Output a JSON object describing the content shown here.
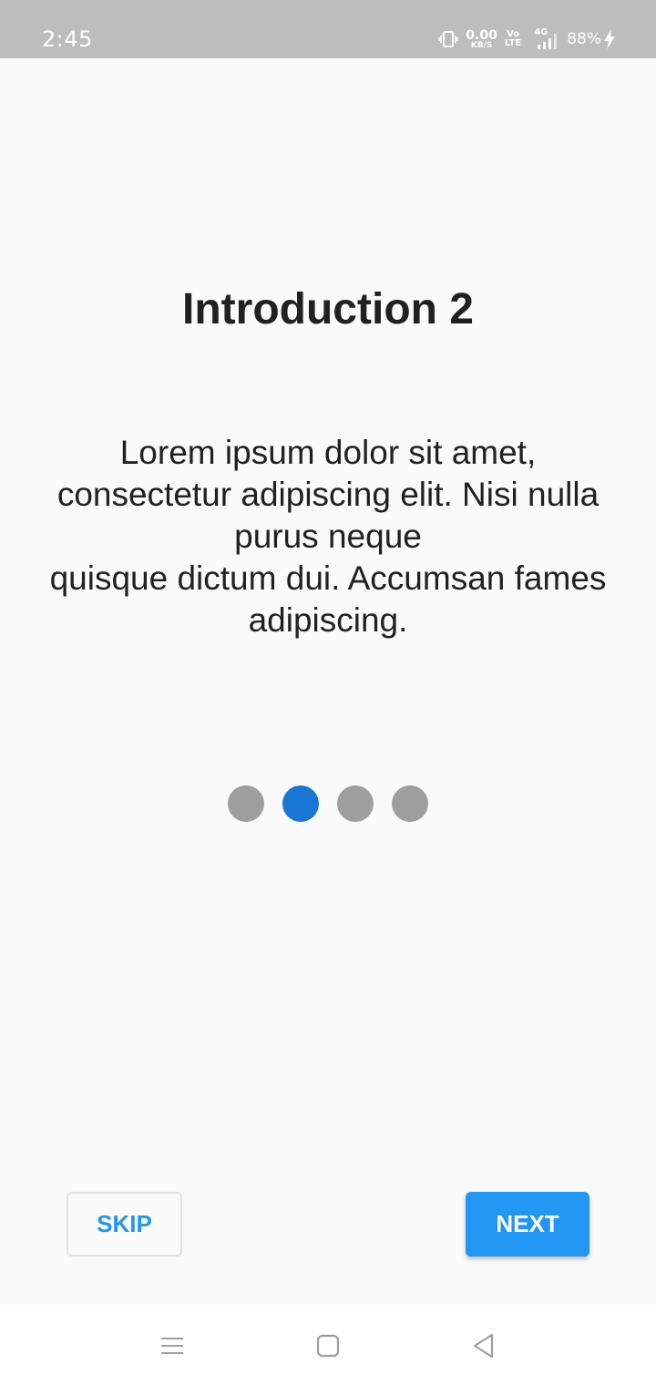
{
  "status_bar": {
    "time": "2:45",
    "net_speed_value": "0.00",
    "net_speed_unit": "KB/S",
    "volte_top": "Vo",
    "volte_bottom": "LTE",
    "network_type": "4G",
    "battery": "88%",
    "icons": [
      "vibrate-icon",
      "signal-icon",
      "charging-bolt-icon"
    ]
  },
  "intro": {
    "title": "Introduction 2",
    "description": "Lorem ipsum dolor sit amet,\nconsectetur adipiscing elit. Nisi nulla purus neque\n quisque dictum dui. Accumsan fames adipiscing."
  },
  "pager": {
    "total": 4,
    "active_index": 1,
    "active_color": "#1976d2",
    "inactive_color": "#9e9e9e"
  },
  "buttons": {
    "skip_label": "SKIP",
    "next_label": "NEXT",
    "accent": "#2196f3"
  },
  "nav_bar": {
    "icons": [
      "menu-icon",
      "home-icon",
      "back-icon"
    ]
  }
}
